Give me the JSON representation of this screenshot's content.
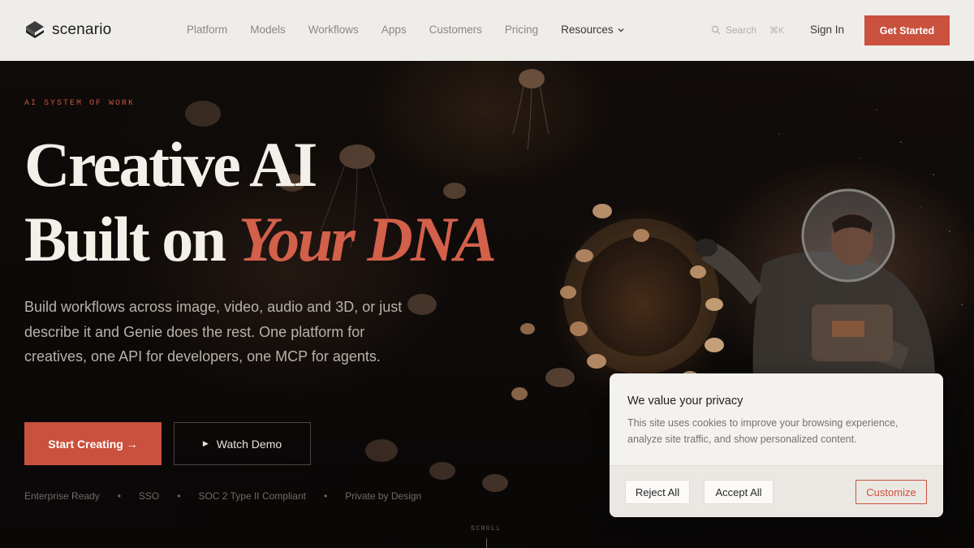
{
  "nav": {
    "logo_text": "scenario",
    "links": [
      "Platform",
      "Models",
      "Workflows",
      "Apps",
      "Customers",
      "Pricing"
    ],
    "resources_label": "Resources",
    "search_placeholder": "Search",
    "search_shortcut": "⌘K",
    "sign_in": "Sign In",
    "get_started": "Get Started"
  },
  "hero": {
    "eyebrow": "AI SYSTEM OF WORK",
    "headline_line1": "Creative AI",
    "headline_line2_prefix": "Built on ",
    "headline_line2_accent": "Your DNA",
    "subcopy": "Build workflows across image, video, audio and 3D, or just describe it and Genie does the rest. One platform for creatives, one API for developers, one MCP for agents.",
    "primary_cta": "Start Creating →",
    "secondary_cta": "Watch Demo",
    "badges": [
      "Enterprise Ready",
      "SSO",
      "SOC 2 Type II Compliant",
      "Private by Design"
    ],
    "badge_separator": "•",
    "scroll_label": "SCROLL"
  },
  "cookie_banner": {
    "title": "We value your privacy",
    "body": "This site uses cookies to improve your browsing experience, analyze site traffic, and show personalized content.",
    "reject": "Reject All",
    "accept": "Accept All",
    "customize": "Customize"
  },
  "colors": {
    "accent": "#c9513d",
    "nav_bg": "#efedea",
    "hero_bg": "#0d0a09"
  }
}
